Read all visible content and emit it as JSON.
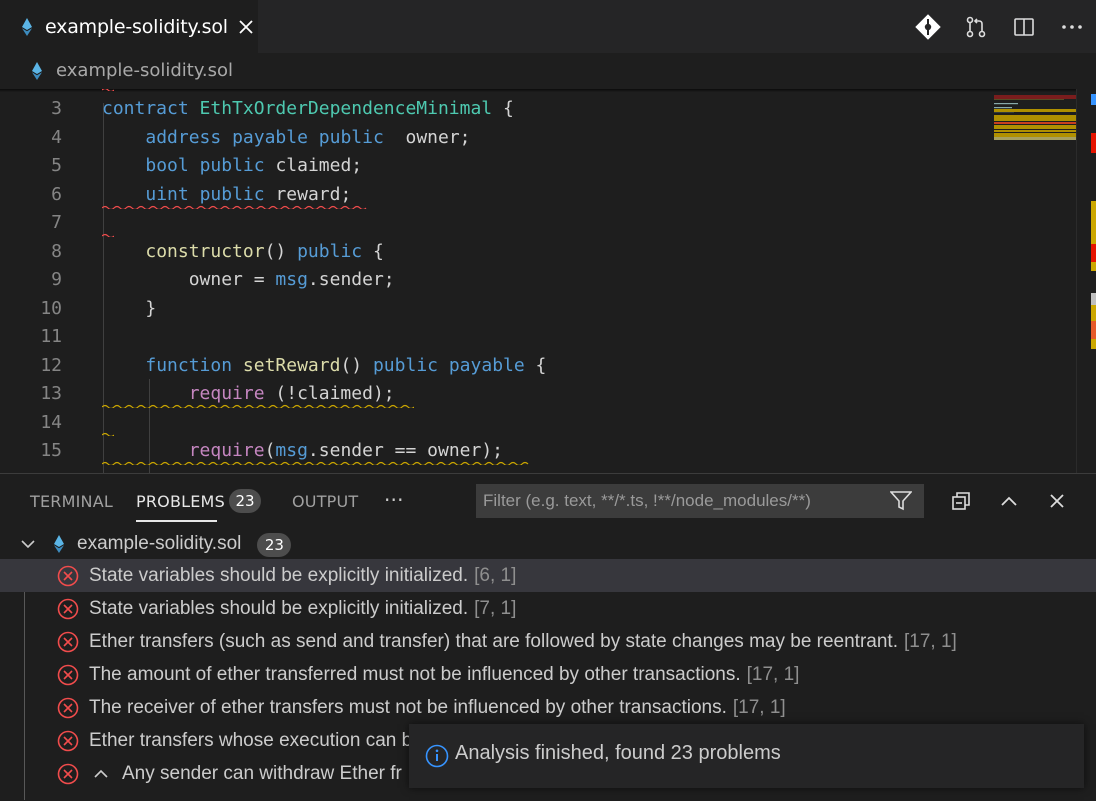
{
  "editor_tab": {
    "title": "example-solidity.sol",
    "icon": "ethereum-icon"
  },
  "editor_actions": [
    "git-commit-icon",
    "pull-request-icon",
    "split-editor-icon",
    "more-actions-icon"
  ],
  "breadcrumb": {
    "file": "example-solidity.sol"
  },
  "code_lines": [
    {
      "n": "3",
      "text": "contract EthTxOrderDependenceMinimal {"
    },
    {
      "n": "4",
      "text": "    address payable public  owner;"
    },
    {
      "n": "5",
      "text": "    bool public claimed;"
    },
    {
      "n": "6",
      "text": "    uint public reward;"
    },
    {
      "n": "7",
      "text": ""
    },
    {
      "n": "8",
      "text": "    constructor() public {"
    },
    {
      "n": "9",
      "text": "        owner = msg.sender;"
    },
    {
      "n": "10",
      "text": "    }"
    },
    {
      "n": "11",
      "text": ""
    },
    {
      "n": "12",
      "text": "    function setReward() public payable {"
    },
    {
      "n": "13",
      "text": "        require (!claimed);"
    },
    {
      "n": "14",
      "text": ""
    },
    {
      "n": "15",
      "text": "        require(msg.sender == owner);"
    }
  ],
  "panel": {
    "tabs": {
      "terminal": "TERMINAL",
      "problems": "PROBLEMS",
      "output": "OUTPUT",
      "more": "···"
    },
    "problems_count": "23",
    "filter_placeholder": "Filter (e.g. text, **/*.ts, !**/node_modules/**)",
    "tree_file": "example-solidity.sol",
    "tree_count": "23",
    "problems": [
      {
        "message": "State variables should be explicitly initialized.",
        "location": "[6, 1]"
      },
      {
        "message": "State variables should be explicitly initialized.",
        "location": "[7, 1]"
      },
      {
        "message": "Ether transfers (such as send and transfer) that are followed by state changes may be reentrant.",
        "location": "[17, 1]"
      },
      {
        "message": "The amount of ether transferred must not be influenced by other transactions.",
        "location": "[17, 1]"
      },
      {
        "message": "The receiver of ether transfers must not be influenced by other transactions.",
        "location": "[17, 1]"
      },
      {
        "message": "Ether transfers whose execution can b",
        "location": ""
      },
      {
        "message": "Any sender can withdraw Ether fr",
        "location": ""
      }
    ]
  },
  "notification": {
    "text": "Analysis finished, found 23 problems",
    "icon": "info-icon"
  },
  "colors": {
    "error": "#f14c4c",
    "warning": "#cca700",
    "accent": "#0e639c"
  }
}
